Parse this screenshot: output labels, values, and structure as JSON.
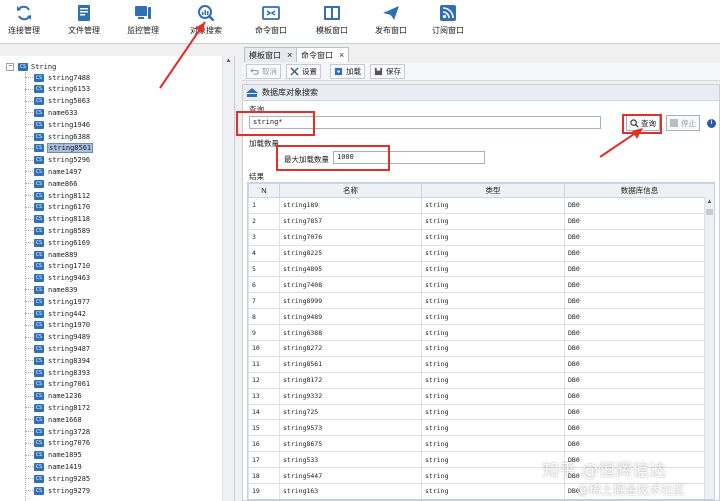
{
  "toolbar": {
    "items": [
      {
        "label": "连接管理",
        "icon": "refresh-icon"
      },
      {
        "label": "文件管理",
        "icon": "file-icon"
      },
      {
        "label": "监控管理",
        "icon": "monitor-icon"
      },
      {
        "label": "对象搜索",
        "icon": "search-chart-icon"
      },
      {
        "label": "命令窗口",
        "icon": "terminal-icon"
      },
      {
        "label": "模板窗口",
        "icon": "template-icon"
      },
      {
        "label": "发布窗口",
        "icon": "send-icon"
      },
      {
        "label": "订阅窗口",
        "icon": "rss-icon"
      }
    ]
  },
  "tree": {
    "root_label": "String",
    "selected_index": 6,
    "items": [
      "string7488",
      "string6153",
      "string5063",
      "name633",
      "string1946",
      "string6388",
      "string8561",
      "string5296",
      "name1497",
      "name866",
      "string8112",
      "string6170",
      "string8118",
      "string8589",
      "string6169",
      "name889",
      "string1710",
      "string9463",
      "name839",
      "string1977",
      "string442",
      "string1970",
      "string9489",
      "string9487",
      "string8394",
      "string8393",
      "string7061",
      "name1236",
      "string8172",
      "name1668",
      "string3728",
      "string7076",
      "name1895",
      "name1419",
      "string9285",
      "string9279"
    ]
  },
  "tabs": [
    {
      "label": "模板窗口",
      "active": false
    },
    {
      "label": "命令窗口",
      "active": true
    }
  ],
  "subtoolbar": {
    "cancel": "取消",
    "settings": "设置",
    "load": "加载",
    "save": "保存"
  },
  "panel": {
    "title": "数据库对象搜索",
    "query_label": "查询",
    "query_value": "string*",
    "query_button": "查询",
    "stop_button": "停止",
    "load_group_label": "加载数量",
    "max_label": "最大加载数量",
    "max_value": "1000",
    "results_label": "结果"
  },
  "table": {
    "headers": [
      "N",
      "名称",
      "类型",
      "数据库信息"
    ],
    "rows": [
      [
        "1",
        "string189",
        "string",
        "DB0"
      ],
      [
        "2",
        "string7857",
        "string",
        "DB0"
      ],
      [
        "3",
        "string7076",
        "string",
        "DB0"
      ],
      [
        "4",
        "string8225",
        "string",
        "DB0"
      ],
      [
        "5",
        "string4895",
        "string",
        "DB0"
      ],
      [
        "6",
        "string7408",
        "string",
        "DB0"
      ],
      [
        "7",
        "string8999",
        "string",
        "DB0"
      ],
      [
        "8",
        "string9489",
        "string",
        "DB0"
      ],
      [
        "9",
        "string6388",
        "string",
        "DB0"
      ],
      [
        "10",
        "string8272",
        "string",
        "DB0"
      ],
      [
        "11",
        "string8561",
        "string",
        "DB0"
      ],
      [
        "12",
        "string8172",
        "string",
        "DB0"
      ],
      [
        "13",
        "string9332",
        "string",
        "DB0"
      ],
      [
        "14",
        "string725",
        "string",
        "DB0"
      ],
      [
        "15",
        "string9573",
        "string",
        "DB0"
      ],
      [
        "16",
        "string8675",
        "string",
        "DB0"
      ],
      [
        "17",
        "string533",
        "string",
        "DB0"
      ],
      [
        "18",
        "string5447",
        "string",
        "DB0"
      ],
      [
        "19",
        "string163",
        "string",
        "DB0"
      ]
    ]
  },
  "watermark": {
    "line1": "知乎 @恒辉信达",
    "line2": "@稀土掘金技术社区"
  },
  "colors": {
    "annotation_red": "#e0302a",
    "icon_blue": "#2f6fb6"
  }
}
